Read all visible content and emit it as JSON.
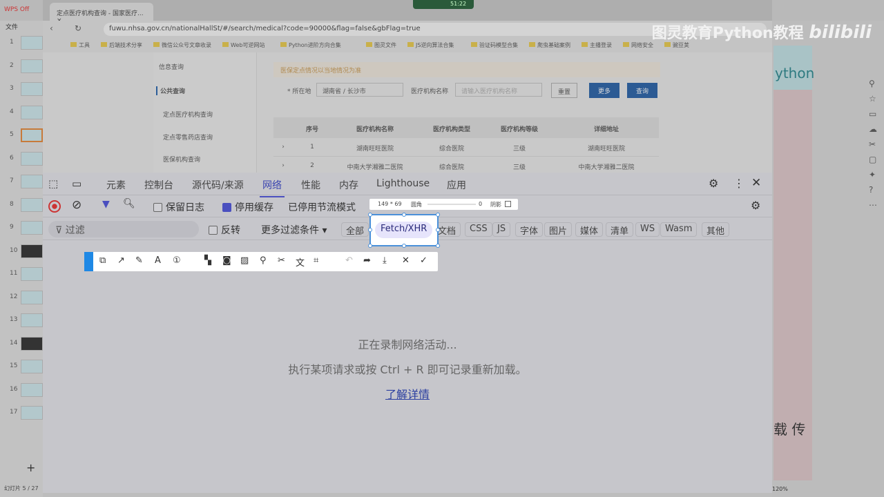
{
  "wps": {
    "tab": "WPS Off",
    "menu": "文件",
    "slide_numbers": [
      "1",
      "2",
      "3",
      "4",
      "5",
      "6",
      "7",
      "8",
      "9",
      "10",
      "11",
      "12",
      "13",
      "14",
      "15",
      "16",
      "17"
    ],
    "status": "幻灯片 5 / 27",
    "zoom": "120%",
    "slide_text_top": "ython",
    "slide_text_bottom": "载 传"
  },
  "recording": {
    "time": "51:22"
  },
  "browser": {
    "tab_title": "定点医疗机构查询 - 国家医疗...",
    "url": "fuwu.nhsa.gov.cn/nationalHallSt/#/search/medical?code=90000&flag=false&gbFlag=true",
    "bookmarks": [
      "工具",
      "后端技术分享",
      "微信公众号文章收录",
      "Web可逆网站",
      "Python进阶方向合集",
      "图灵文件",
      "JS逆向算法合集",
      "验证码模型合集",
      "爬虫基础案例",
      "主播登录",
      "网络安全",
      "豌豆荚"
    ]
  },
  "watermark": "图灵教育Python教程",
  "bilibili": "bilibili",
  "site": {
    "sidebar": {
      "section": "信息查询",
      "group": "公共查询",
      "items": [
        "定点医疗机构查询",
        "定点零售药店查询",
        "医保机构查询"
      ]
    },
    "notice": "医保定点情况以当地情况为准",
    "form": {
      "location_label": "* 所在地",
      "location_value": "湖南省 / 长沙市",
      "name_label": "医疗机构名称",
      "name_placeholder": "请输入医疗机构名称",
      "reset": "重置",
      "more": "更多",
      "search": "查询"
    },
    "table": {
      "headers": [
        "序号",
        "医疗机构名称",
        "医疗机构类型",
        "医疗机构等级",
        "详细地址"
      ],
      "rows": [
        [
          "1",
          "湖南旺旺医院",
          "综合医院",
          "三级",
          "湖南旺旺医院"
        ],
        [
          "2",
          "中南大学湘雅二医院",
          "综合医院",
          "三级",
          "中南大学湘雅二医院"
        ]
      ]
    }
  },
  "devtools": {
    "tabs": [
      "元素",
      "控制台",
      "源代码/来源",
      "网络",
      "性能",
      "内存",
      "Lighthouse",
      "应用"
    ],
    "active_tab": "网络",
    "preserve_log": "保留日志",
    "disable_cache": "停用缓存",
    "throttle": "已停用节流模式",
    "filter_placeholder": "过滤",
    "invert": "反转",
    "more_filters": "更多过滤条件 ▾",
    "types": [
      "全部",
      "Fetch/XHR",
      "文档",
      "CSS",
      "JS",
      "字体",
      "图片",
      "媒体",
      "清单",
      "WS",
      "Wasm",
      "其他"
    ],
    "empty_line1": "正在录制网络活动...",
    "empty_line2": "执行某项请求或按 Ctrl + R 即可记录重新加载。",
    "learn_more": "了解详情"
  },
  "snip": {
    "size": "149 * 69",
    "corner_label": "圆角",
    "corner_value": "0",
    "shadow_label": "阴影"
  }
}
